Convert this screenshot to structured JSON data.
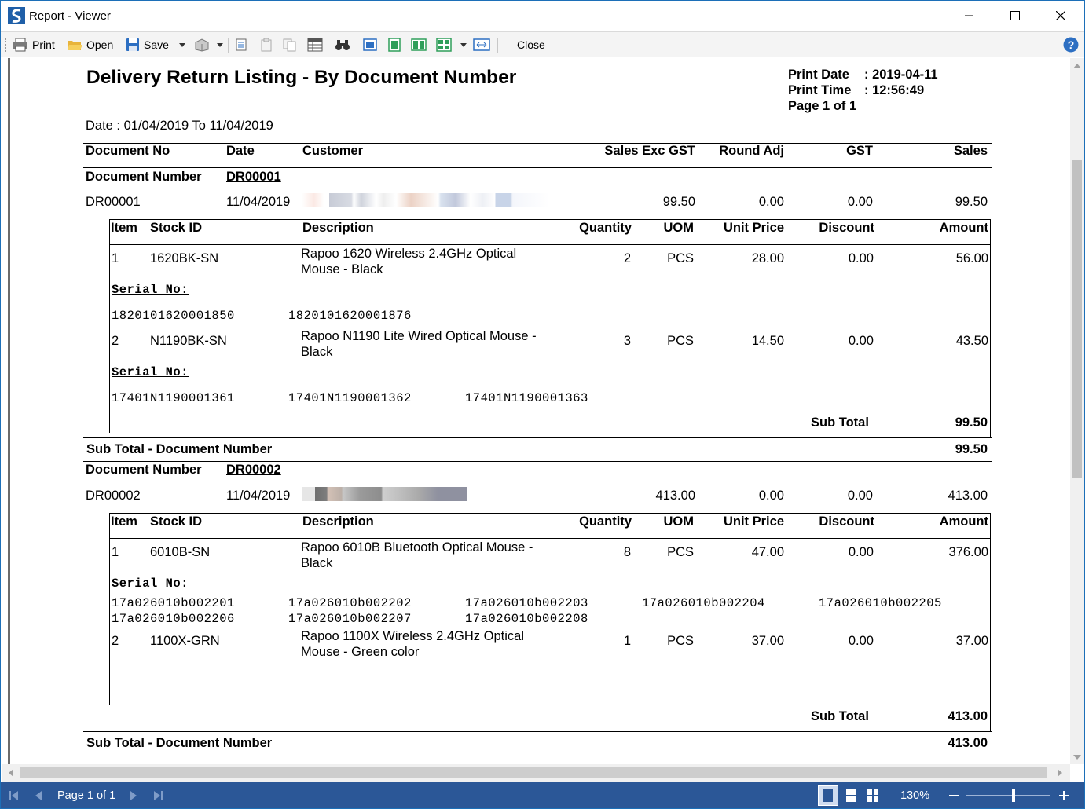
{
  "window": {
    "title": "Report - Viewer",
    "controls": [
      "minimize",
      "maximize",
      "close"
    ]
  },
  "toolbar": {
    "print": "Print",
    "open": "Open",
    "save": "Save",
    "close": "Close"
  },
  "report": {
    "title": "Delivery Return Listing - By Document Number",
    "print_date_label": "Print Date",
    "print_date": ": 2019-04-11",
    "print_time_label": "Print Time",
    "print_time": ": 12:56:49",
    "page_info": "Page 1 of 1",
    "date_range": "Date : 01/04/2019 To 11/04/2019",
    "columns": {
      "doc_no": "Document No",
      "date": "Date",
      "customer": "Customer",
      "sales_exc": "Sales Exc GST",
      "round_adj": "Round Adj",
      "gst": "GST",
      "sales": "Sales"
    },
    "detail_columns": {
      "item": "Item",
      "stock_id": "Stock ID",
      "description": "Description",
      "quantity": "Quantity",
      "uom": "UOM",
      "unit_price": "Unit Price",
      "discount": "Discount",
      "amount": "Amount"
    },
    "doc_number_label": "Document Number",
    "serial_label": "Serial No:",
    "sub_total_label": "Sub Total",
    "sub_total_doc_label": "Sub Total - Document Number",
    "documents": [
      {
        "number": "DR00001",
        "doc_no": "DR00001",
        "date": "11/04/2019",
        "sales_exc": "99.50",
        "round_adj": "0.00",
        "gst": "0.00",
        "sales": "99.50",
        "items": [
          {
            "item": "1",
            "stock_id": "1620BK-SN",
            "desc_l1": "Rapoo 1620 Wireless 2.4GHz Optical",
            "desc_l2": "Mouse - Black",
            "quantity": "2",
            "uom": "PCS",
            "unit_price": "28.00",
            "discount": "0.00",
            "amount": "56.00",
            "serials": [
              "1820101620001850",
              "1820101620001876"
            ]
          },
          {
            "item": "2",
            "stock_id": "N1190BK-SN",
            "desc_l1": "Rapoo N1190 Lite Wired Optical Mouse -",
            "desc_l2": "Black",
            "quantity": "3",
            "uom": "PCS",
            "unit_price": "14.50",
            "discount": "0.00",
            "amount": "43.50",
            "serials": [
              "17401N1190001361",
              "17401N1190001362",
              "17401N1190001363"
            ]
          }
        ],
        "sub_total": "99.50",
        "sub_total_doc": "99.50"
      },
      {
        "number": "DR00002",
        "doc_no": "DR00002",
        "date": "11/04/2019",
        "sales_exc": "413.00",
        "round_adj": "0.00",
        "gst": "0.00",
        "sales": "413.00",
        "items": [
          {
            "item": "1",
            "stock_id": "6010B-SN",
            "desc_l1": "Rapoo 6010B Bluetooth Optical Mouse -",
            "desc_l2": "Black",
            "quantity": "8",
            "uom": "PCS",
            "unit_price": "47.00",
            "discount": "0.00",
            "amount": "376.00",
            "serials": [
              "17a026010b002201",
              "17a026010b002202",
              "17a026010b002203",
              "17a026010b002204",
              "17a026010b002205",
              "17a026010b002206",
              "17a026010b002207",
              "17a026010b002208"
            ]
          },
          {
            "item": "2",
            "stock_id": "1100X-GRN",
            "desc_l1": "Rapoo 1100X Wireless 2.4GHz Optical",
            "desc_l2": "Mouse - Green color",
            "quantity": "1",
            "uom": "PCS",
            "unit_price": "37.00",
            "discount": "0.00",
            "amount": "37.00"
          }
        ],
        "sub_total": "413.00",
        "sub_total_doc": "413.00"
      }
    ]
  },
  "statusbar": {
    "page_indicator": "Page 1 of 1",
    "zoom": "130%",
    "zoom_level_fraction": 0.6
  },
  "colors": {
    "statusbar": "#2b5797",
    "title_border": "#1c6fb8",
    "page_edge": "#6b6b6b"
  }
}
